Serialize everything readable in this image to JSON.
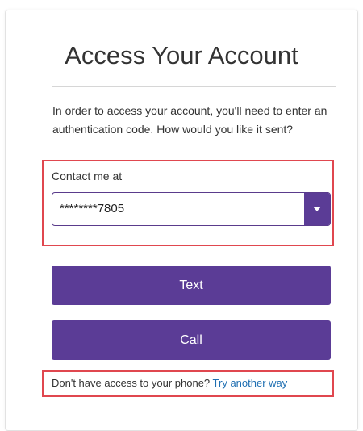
{
  "title": "Access Your Account",
  "instructions": "In order to access your account, you'll need to enter an authentication code. How would you like it sent?",
  "contact": {
    "label": "Contact me at",
    "selected_value": "********7805",
    "caret_icon": "chevron-down-icon"
  },
  "buttons": {
    "text_label": "Text",
    "call_label": "Call"
  },
  "footer": {
    "prompt": "Don't have access to your phone? ",
    "link_label": "Try another way"
  },
  "colors": {
    "accent": "#5b3c96",
    "highlight": "#e0474f",
    "link": "#1f6fb2"
  }
}
